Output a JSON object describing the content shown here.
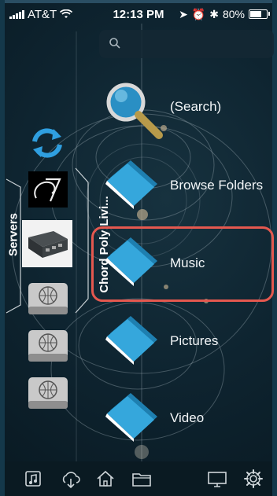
{
  "status_bar": {
    "carrier": "AT&T",
    "time": "12:13 PM",
    "battery": "80%",
    "battery_level": 0.8
  },
  "search": {
    "placeholder": ""
  },
  "sidebar": {
    "label": "Servers",
    "current_server_label": "Chord Poly:Livi...",
    "items": [
      {
        "icon": "refresh-icon"
      },
      {
        "icon": "chord-logo-icon"
      },
      {
        "icon": "chord-poly-device-icon"
      },
      {
        "icon": "network-drive-icon"
      },
      {
        "icon": "network-drive-icon"
      },
      {
        "icon": "network-drive-icon"
      }
    ]
  },
  "menu": {
    "items": [
      {
        "label": "(Search)",
        "icon": "magnifier-icon"
      },
      {
        "label": "Browse Folders",
        "icon": "folder-icon"
      },
      {
        "label": "Music",
        "icon": "folder-icon"
      },
      {
        "label": "Pictures",
        "icon": "folder-icon"
      },
      {
        "label": "Video",
        "icon": "folder-icon"
      }
    ],
    "highlighted": "Music",
    "highlight_color": "#e4584f"
  },
  "toolbar": {
    "items": [
      {
        "icon": "music-note-icon"
      },
      {
        "icon": "cloud-download-icon"
      },
      {
        "icon": "home-icon"
      },
      {
        "icon": "folder-outline-icon"
      },
      {
        "icon": "monitor-icon"
      },
      {
        "icon": "settings-gear-icon"
      }
    ]
  },
  "colors": {
    "accent_blue": "#3aa7d9",
    "folder_blue": "#2f9fd4",
    "background": "#0e2430"
  }
}
